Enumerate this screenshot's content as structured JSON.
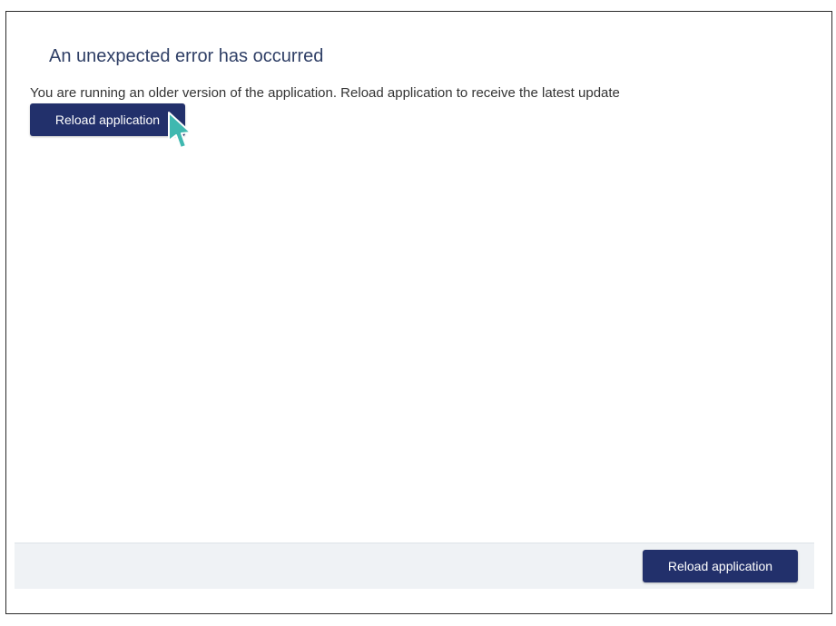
{
  "dialog": {
    "title": "An unexpected error has occurred",
    "message": "You are running an older version of the application. Reload application to receive the latest update",
    "reload_button_label": "Reload application"
  },
  "footer": {
    "reload_button_label": "Reload application"
  },
  "colors": {
    "title_text": "#2f3f66",
    "button_bg": "#22306b",
    "footer_bg": "#eff2f5",
    "cursor": "#3fb8b0"
  },
  "icons": {
    "cursor": "mouse-pointer-icon"
  }
}
